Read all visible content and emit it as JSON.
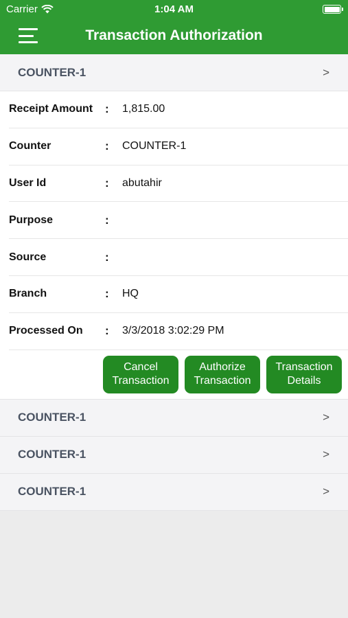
{
  "status_bar": {
    "carrier": "Carrier",
    "time": "1:04 AM"
  },
  "nav": {
    "title": "Transaction Authorization"
  },
  "sections": [
    {
      "label": "COUNTER-1",
      "chevron": ">"
    },
    {
      "label": "COUNTER-1",
      "chevron": ">"
    },
    {
      "label": "COUNTER-1",
      "chevron": ">"
    },
    {
      "label": "COUNTER-1",
      "chevron": ">"
    }
  ],
  "details": [
    {
      "label": "Receipt Amount",
      "colon": ":",
      "value": "1,815.00"
    },
    {
      "label": "Counter",
      "colon": ":",
      "value": "COUNTER-1"
    },
    {
      "label": "User Id",
      "colon": ":",
      "value": "abutahir"
    },
    {
      "label": "Purpose",
      "colon": ":",
      "value": ""
    },
    {
      "label": "Source",
      "colon": ":",
      "value": ""
    },
    {
      "label": "Branch",
      "colon": ":",
      "value": "HQ"
    },
    {
      "label": "Processed On",
      "colon": ":",
      "value": "3/3/2018 3:02:29 PM"
    }
  ],
  "actions": {
    "cancel": "Cancel\nTransaction",
    "authorize": "Authorize\nTransaction",
    "details": "Transaction\nDetails"
  },
  "colors": {
    "header": "#2f9b33",
    "button": "#238a23",
    "section_bg": "#f4f4f6"
  }
}
